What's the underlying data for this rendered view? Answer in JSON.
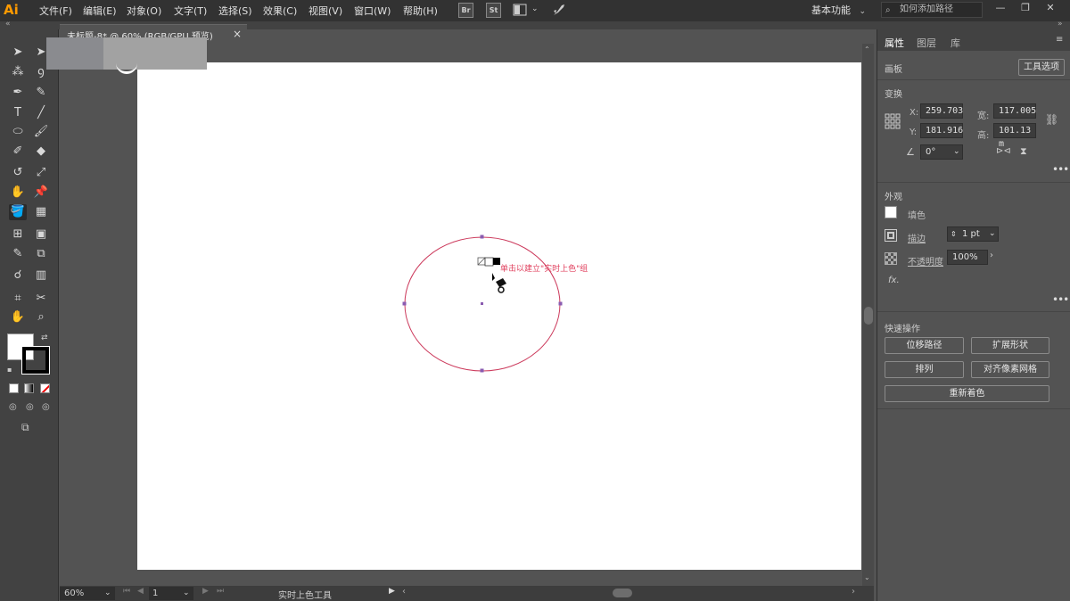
{
  "app": {
    "logo": "Ai"
  },
  "menu": [
    "文件(F)",
    "编辑(E)",
    "对象(O)",
    "文字(T)",
    "选择(S)",
    "效果(C)",
    "视图(V)",
    "窗口(W)",
    "帮助(H)"
  ],
  "app_switch": [
    "Br",
    "St"
  ],
  "workspace": "基本功能",
  "search_placeholder": "如何添加路径",
  "document_tab": {
    "title": "未标题-8* @ 60% (RGB/GPU 预览)",
    "close": "×"
  },
  "canvas": {
    "hint_text": "单击以建立\"实时上色\"组",
    "ellipse_stroke": "#cc3a5c",
    "anchor_color": "#8a5bb0"
  },
  "status": {
    "zoom": "60%",
    "page": "1",
    "tool_name": "实时上色工具"
  },
  "panel": {
    "tabs": [
      "属性",
      "图层",
      "库"
    ],
    "active_tab": "属性",
    "view_label": "画板",
    "tool_options_button": "工具选项",
    "transform": {
      "title": "变换",
      "x_label": "X:",
      "x_value": "259.703",
      "y_label": "Y:",
      "y_value": "181.916",
      "w_label": "宽:",
      "w_value": "117.005",
      "h_label": "高:",
      "h_value": "101.13 m",
      "angle_value": "0°"
    },
    "appearance": {
      "title": "外观",
      "fill_label": "填色",
      "stroke_label": "描边",
      "stroke_value": "1 pt",
      "opacity_label": "不透明度",
      "opacity_value": "100%",
      "fx_label": "fx."
    },
    "quick_actions": {
      "title": "快速操作",
      "buttons": [
        "位移路径",
        "扩展形状",
        "排列",
        "对齐像素网格",
        "重新着色"
      ]
    }
  }
}
